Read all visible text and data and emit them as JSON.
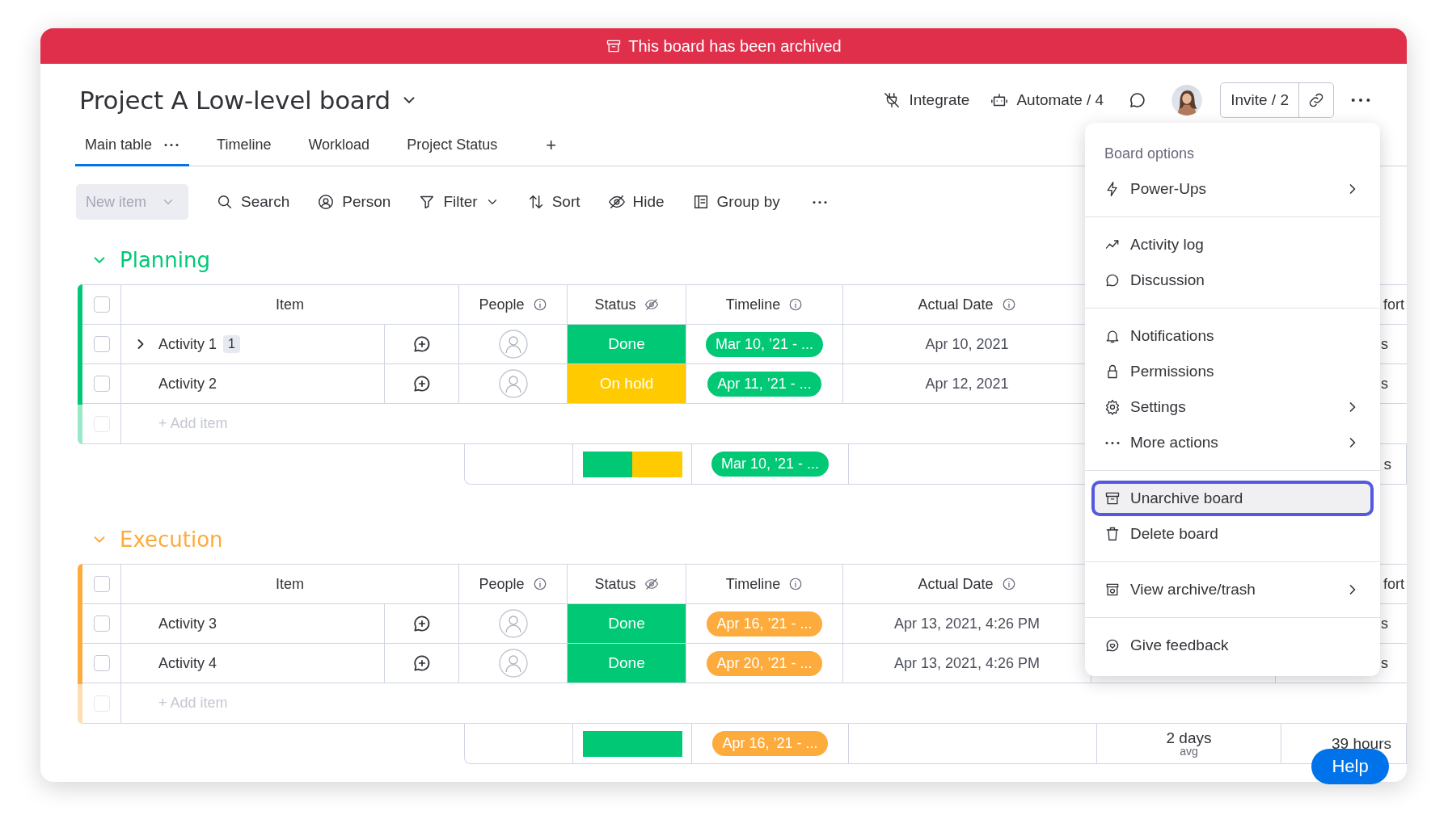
{
  "banner": {
    "text": "This board has been archived"
  },
  "board": {
    "title": "Project A Low-level board"
  },
  "header_actions": {
    "integrate": "Integrate",
    "automate": "Automate / 4",
    "invite": "Invite / 2"
  },
  "tabs": [
    {
      "label": "Main table",
      "selected": true
    },
    {
      "label": "Timeline",
      "selected": false
    },
    {
      "label": "Workload",
      "selected": false
    },
    {
      "label": "Project Status",
      "selected": false
    }
  ],
  "add_tab": "+",
  "toolbar": {
    "new_item": {
      "label": "New item",
      "disabled": true
    },
    "items": [
      {
        "label": "Search",
        "has_menu": false
      },
      {
        "label": "Person",
        "has_menu": false
      },
      {
        "label": "Filter",
        "has_menu": true
      },
      {
        "label": "Sort",
        "has_menu": false
      },
      {
        "label": "Hide",
        "has_menu": false
      },
      {
        "label": "Group by",
        "has_menu": false
      }
    ]
  },
  "groups": [
    {
      "name": "Planning",
      "color": "#00c875",
      "expanded": true,
      "all_checked": false,
      "columns": [
        {
          "label": "Item",
          "kind": "item"
        },
        {
          "label": "People",
          "kind": "people"
        },
        {
          "label": "Status",
          "kind": "status"
        },
        {
          "label": "Timeline",
          "kind": "timeline"
        },
        {
          "label": "Actual Date",
          "kind": "date"
        }
      ],
      "column_8_label": "fort",
      "rows": [
        {
          "name": "Activity 1",
          "checked": false,
          "subitem_count": "1",
          "status": {
            "label": "Done",
            "color": "#00c875"
          },
          "timeline": "Mar 10, ’21 - ...",
          "actual_date": "Apr 10, 2021",
          "column_8": "s"
        },
        {
          "name": "Activity 2",
          "checked": false,
          "status": {
            "label": "On hold",
            "color": "#ffcb00"
          },
          "timeline": "Apr 11, ’21 - ...",
          "actual_date": "Apr 12, 2021",
          "column_8": "s"
        }
      ],
      "add_item": {
        "placeholder": "+ Add item",
        "disabled": true
      },
      "summary": {
        "status_segments": [
          {
            "color": "#00c875",
            "level": 0.5
          },
          {
            "color": "#ffcb00",
            "level": 0.5
          }
        ],
        "timeline": "Mar 10, ’21 - ...",
        "column_8": "s"
      }
    },
    {
      "name": "Execution",
      "color": "#fdab3d",
      "expanded": true,
      "all_checked": false,
      "columns": [
        {
          "label": "Item",
          "kind": "item"
        },
        {
          "label": "People",
          "kind": "people"
        },
        {
          "label": "Status",
          "kind": "status"
        },
        {
          "label": "Timeline",
          "kind": "timeline"
        },
        {
          "label": "Actual Date",
          "kind": "date"
        }
      ],
      "column_8_label": "fort",
      "rows": [
        {
          "name": "Activity 3",
          "checked": false,
          "status": {
            "label": "Done",
            "color": "#00c875"
          },
          "timeline": "Apr 16, ’21 - ...",
          "actual_date": "Apr 13, 2021, 4:26 PM",
          "column_8": "s"
        },
        {
          "name": "Activity 4",
          "checked": false,
          "status": {
            "label": "Done",
            "color": "#00c875"
          },
          "timeline": "Apr 20, ’21 - ...",
          "actual_date": "Apr 13, 2021, 4:26 PM",
          "column_8": "s"
        }
      ],
      "add_item": {
        "placeholder": "+ Add item",
        "disabled": true
      },
      "summary": {
        "status_segments": [
          {
            "color": "#00c875",
            "level": 1
          }
        ],
        "timeline": "Apr 16, ’21 - ...",
        "column_7": {
          "value": "2 days",
          "caption": "avg"
        },
        "column_8": "39 hours"
      }
    }
  ],
  "menu": {
    "title": "Board options",
    "sections": [
      {
        "items": [
          {
            "label": "Power-Ups",
            "submenu": true,
            "selected": false
          }
        ]
      },
      {
        "items": [
          {
            "label": "Activity log",
            "submenu": false,
            "selected": false
          },
          {
            "label": "Discussion",
            "submenu": false,
            "selected": false
          }
        ]
      },
      {
        "items": [
          {
            "label": "Notifications",
            "submenu": false,
            "selected": false
          },
          {
            "label": "Permissions",
            "submenu": false,
            "selected": false
          },
          {
            "label": "Settings",
            "submenu": true,
            "selected": false
          },
          {
            "label": "More actions",
            "submenu": true,
            "selected": false
          }
        ]
      },
      {
        "items": [
          {
            "label": "Unarchive board",
            "submenu": false,
            "selected": true
          },
          {
            "label": "Delete board",
            "submenu": false,
            "selected": false
          }
        ]
      },
      {
        "items": [
          {
            "label": "View archive/trash",
            "submenu": true,
            "selected": false
          }
        ]
      },
      {
        "items": [
          {
            "label": "Give feedback",
            "submenu": false,
            "selected": false
          }
        ]
      }
    ]
  },
  "help": "Help"
}
